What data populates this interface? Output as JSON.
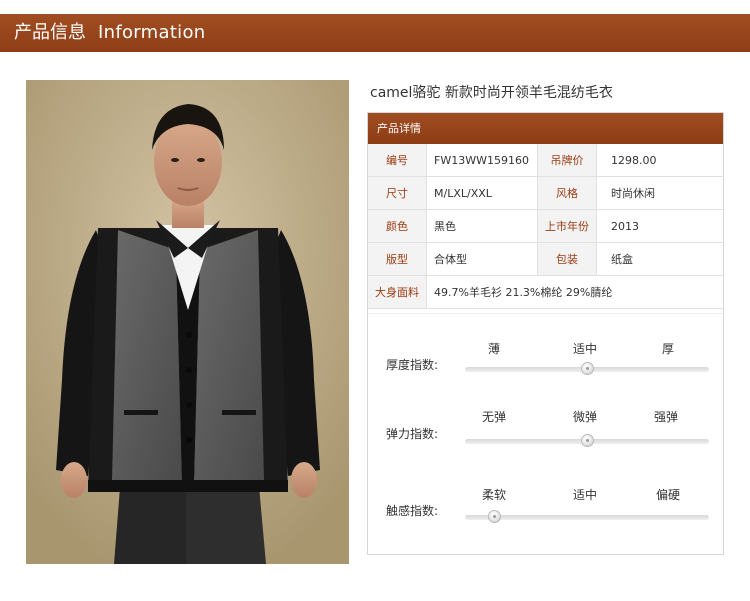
{
  "banner": {
    "title_cn": "产品信息",
    "title_en": "Information"
  },
  "product": {
    "title": "camel骆驼  新款时尚开领羊毛混纺毛衣"
  },
  "panel": {
    "header": "产品详情",
    "rows": [
      {
        "k1": "编号",
        "v1": "FW13WW159160",
        "k2": "吊牌价",
        "v2": "1298.00"
      },
      {
        "k1": "尺寸",
        "v1": "M/LXL/XXL",
        "k2": "风格",
        "v2": "时尚休闲"
      },
      {
        "k1": "颜色",
        "v1": "黑色",
        "k2": "上市年份",
        "v2": "2013"
      },
      {
        "k1": "版型",
        "v1": "合体型",
        "k2": "包装",
        "v2": "纸盒"
      }
    ],
    "fabric": {
      "k": "大身面料",
      "v": "49.7%羊毛衫  21.3%棉纶  29%腈纶"
    }
  },
  "sliders": [
    {
      "label": "厚度指数:",
      "options": [
        "薄",
        "适中",
        "厚"
      ],
      "level": 0.5
    },
    {
      "label": "弹力指数:",
      "options": [
        "无弹",
        "微弹",
        "强弹"
      ],
      "level": 0.5
    },
    {
      "label": "触感指数:",
      "options": [
        "柔软",
        "适中",
        "偏硬"
      ],
      "level": 0.12
    }
  ],
  "colors": {
    "banner": "#9a4620",
    "key_text": "#9b3b10"
  }
}
